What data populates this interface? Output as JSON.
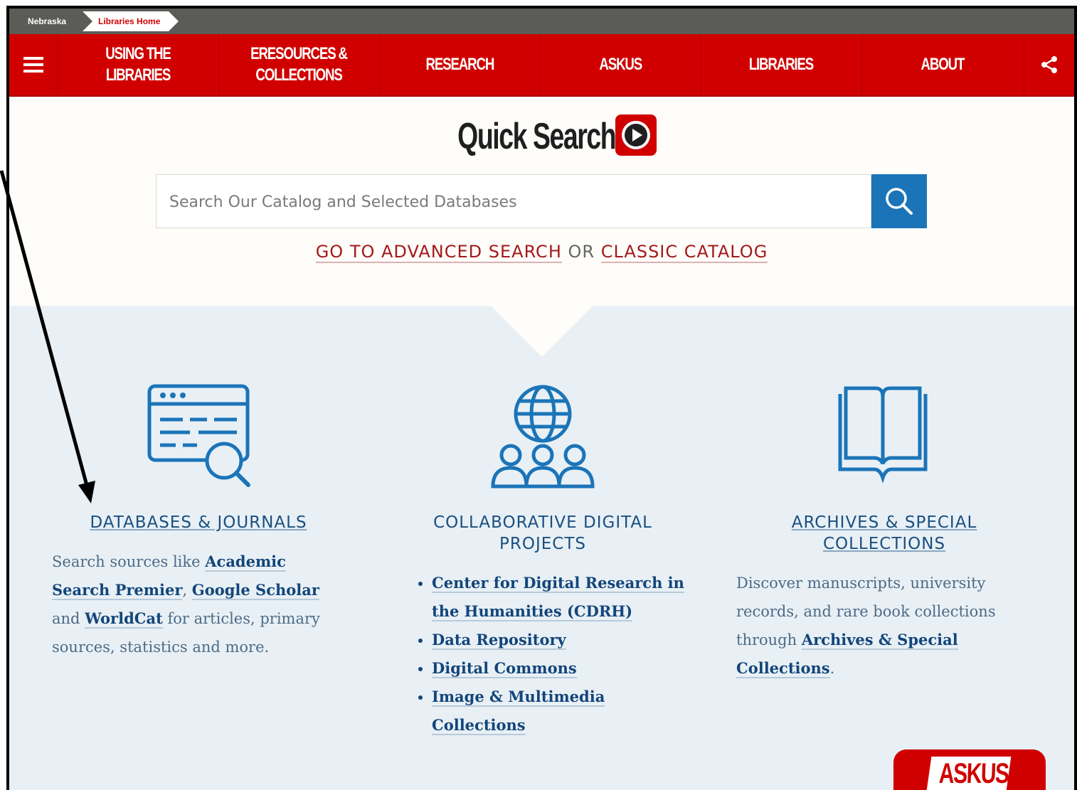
{
  "breadcrumb": {
    "items": [
      "Nebraska",
      "Libraries Home"
    ]
  },
  "nav": {
    "items": [
      "USING THE LIBRARIES",
      "ERESOURCES &\nCOLLECTIONS",
      "RESEARCH",
      "ASKUS",
      "LIBRARIES",
      "ABOUT"
    ],
    "menu_icon": "hamburger-icon",
    "share_icon": "share-icon"
  },
  "quick_search": {
    "title": "Quick Search",
    "placeholder": "Search Our Catalog and Selected Databases",
    "advanced_link": "GO TO ADVANCED SEARCH",
    "or_text": "OR",
    "classic_link": "CLASSIC CATALOG"
  },
  "columns": {
    "databases": {
      "heading": "DATABASES & JOURNALS",
      "text_1": "Search sources like ",
      "link_1": "Academic Search Premier",
      "sep_1": ", ",
      "link_2": "Google Scholar",
      "text_2": " and ",
      "link_3": "WorldCat",
      "text_3": " for articles, primary sources, statistics and more."
    },
    "digital": {
      "heading": "COLLABORATIVE DIGITAL PROJECTS",
      "items": [
        "Center for Digital Research in the Humanities (CDRH)",
        "Data Repository",
        "Digital Commons",
        "Image & Multimedia Collections"
      ]
    },
    "archives": {
      "heading": "ARCHIVES & SPECIAL COLLECTIONS",
      "text_1": "Discover manuscripts, university records, and rare book collections through ",
      "link_1": "Archives & Special Collections",
      "text_2": "."
    }
  },
  "askus_button": {
    "label": "ASKUS"
  },
  "colors": {
    "brand_red": "#d00000",
    "link_blue": "#13457a",
    "search_blue": "#1b74b8",
    "panel_bg": "#e8f0f5"
  }
}
